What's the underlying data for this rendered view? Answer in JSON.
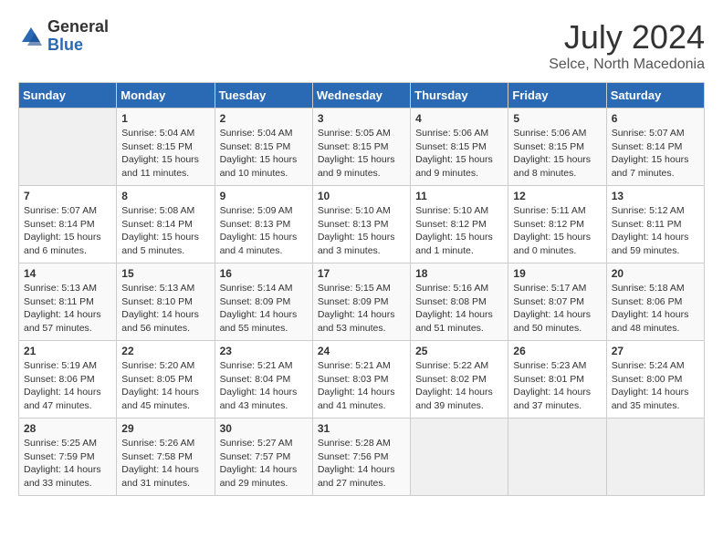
{
  "header": {
    "logo_general": "General",
    "logo_blue": "Blue",
    "month_year": "July 2024",
    "location": "Selce, North Macedonia"
  },
  "days_of_week": [
    "Sunday",
    "Monday",
    "Tuesday",
    "Wednesday",
    "Thursday",
    "Friday",
    "Saturday"
  ],
  "weeks": [
    [
      {
        "day": "",
        "sunrise": "",
        "sunset": "",
        "daylight": "",
        "empty": true
      },
      {
        "day": "1",
        "sunrise": "Sunrise: 5:04 AM",
        "sunset": "Sunset: 8:15 PM",
        "daylight": "Daylight: 15 hours and 11 minutes."
      },
      {
        "day": "2",
        "sunrise": "Sunrise: 5:04 AM",
        "sunset": "Sunset: 8:15 PM",
        "daylight": "Daylight: 15 hours and 10 minutes."
      },
      {
        "day": "3",
        "sunrise": "Sunrise: 5:05 AM",
        "sunset": "Sunset: 8:15 PM",
        "daylight": "Daylight: 15 hours and 9 minutes."
      },
      {
        "day": "4",
        "sunrise": "Sunrise: 5:06 AM",
        "sunset": "Sunset: 8:15 PM",
        "daylight": "Daylight: 15 hours and 9 minutes."
      },
      {
        "day": "5",
        "sunrise": "Sunrise: 5:06 AM",
        "sunset": "Sunset: 8:15 PM",
        "daylight": "Daylight: 15 hours and 8 minutes."
      },
      {
        "day": "6",
        "sunrise": "Sunrise: 5:07 AM",
        "sunset": "Sunset: 8:14 PM",
        "daylight": "Daylight: 15 hours and 7 minutes."
      }
    ],
    [
      {
        "day": "7",
        "sunrise": "Sunrise: 5:07 AM",
        "sunset": "Sunset: 8:14 PM",
        "daylight": "Daylight: 15 hours and 6 minutes."
      },
      {
        "day": "8",
        "sunrise": "Sunrise: 5:08 AM",
        "sunset": "Sunset: 8:14 PM",
        "daylight": "Daylight: 15 hours and 5 minutes."
      },
      {
        "day": "9",
        "sunrise": "Sunrise: 5:09 AM",
        "sunset": "Sunset: 8:13 PM",
        "daylight": "Daylight: 15 hours and 4 minutes."
      },
      {
        "day": "10",
        "sunrise": "Sunrise: 5:10 AM",
        "sunset": "Sunset: 8:13 PM",
        "daylight": "Daylight: 15 hours and 3 minutes."
      },
      {
        "day": "11",
        "sunrise": "Sunrise: 5:10 AM",
        "sunset": "Sunset: 8:12 PM",
        "daylight": "Daylight: 15 hours and 1 minute."
      },
      {
        "day": "12",
        "sunrise": "Sunrise: 5:11 AM",
        "sunset": "Sunset: 8:12 PM",
        "daylight": "Daylight: 15 hours and 0 minutes."
      },
      {
        "day": "13",
        "sunrise": "Sunrise: 5:12 AM",
        "sunset": "Sunset: 8:11 PM",
        "daylight": "Daylight: 14 hours and 59 minutes."
      }
    ],
    [
      {
        "day": "14",
        "sunrise": "Sunrise: 5:13 AM",
        "sunset": "Sunset: 8:11 PM",
        "daylight": "Daylight: 14 hours and 57 minutes."
      },
      {
        "day": "15",
        "sunrise": "Sunrise: 5:13 AM",
        "sunset": "Sunset: 8:10 PM",
        "daylight": "Daylight: 14 hours and 56 minutes."
      },
      {
        "day": "16",
        "sunrise": "Sunrise: 5:14 AM",
        "sunset": "Sunset: 8:09 PM",
        "daylight": "Daylight: 14 hours and 55 minutes."
      },
      {
        "day": "17",
        "sunrise": "Sunrise: 5:15 AM",
        "sunset": "Sunset: 8:09 PM",
        "daylight": "Daylight: 14 hours and 53 minutes."
      },
      {
        "day": "18",
        "sunrise": "Sunrise: 5:16 AM",
        "sunset": "Sunset: 8:08 PM",
        "daylight": "Daylight: 14 hours and 51 minutes."
      },
      {
        "day": "19",
        "sunrise": "Sunrise: 5:17 AM",
        "sunset": "Sunset: 8:07 PM",
        "daylight": "Daylight: 14 hours and 50 minutes."
      },
      {
        "day": "20",
        "sunrise": "Sunrise: 5:18 AM",
        "sunset": "Sunset: 8:06 PM",
        "daylight": "Daylight: 14 hours and 48 minutes."
      }
    ],
    [
      {
        "day": "21",
        "sunrise": "Sunrise: 5:19 AM",
        "sunset": "Sunset: 8:06 PM",
        "daylight": "Daylight: 14 hours and 47 minutes."
      },
      {
        "day": "22",
        "sunrise": "Sunrise: 5:20 AM",
        "sunset": "Sunset: 8:05 PM",
        "daylight": "Daylight: 14 hours and 45 minutes."
      },
      {
        "day": "23",
        "sunrise": "Sunrise: 5:21 AM",
        "sunset": "Sunset: 8:04 PM",
        "daylight": "Daylight: 14 hours and 43 minutes."
      },
      {
        "day": "24",
        "sunrise": "Sunrise: 5:21 AM",
        "sunset": "Sunset: 8:03 PM",
        "daylight": "Daylight: 14 hours and 41 minutes."
      },
      {
        "day": "25",
        "sunrise": "Sunrise: 5:22 AM",
        "sunset": "Sunset: 8:02 PM",
        "daylight": "Daylight: 14 hours and 39 minutes."
      },
      {
        "day": "26",
        "sunrise": "Sunrise: 5:23 AM",
        "sunset": "Sunset: 8:01 PM",
        "daylight": "Daylight: 14 hours and 37 minutes."
      },
      {
        "day": "27",
        "sunrise": "Sunrise: 5:24 AM",
        "sunset": "Sunset: 8:00 PM",
        "daylight": "Daylight: 14 hours and 35 minutes."
      }
    ],
    [
      {
        "day": "28",
        "sunrise": "Sunrise: 5:25 AM",
        "sunset": "Sunset: 7:59 PM",
        "daylight": "Daylight: 14 hours and 33 minutes."
      },
      {
        "day": "29",
        "sunrise": "Sunrise: 5:26 AM",
        "sunset": "Sunset: 7:58 PM",
        "daylight": "Daylight: 14 hours and 31 minutes."
      },
      {
        "day": "30",
        "sunrise": "Sunrise: 5:27 AM",
        "sunset": "Sunset: 7:57 PM",
        "daylight": "Daylight: 14 hours and 29 minutes."
      },
      {
        "day": "31",
        "sunrise": "Sunrise: 5:28 AM",
        "sunset": "Sunset: 7:56 PM",
        "daylight": "Daylight: 14 hours and 27 minutes."
      },
      {
        "day": "",
        "sunrise": "",
        "sunset": "",
        "daylight": "",
        "empty": true
      },
      {
        "day": "",
        "sunrise": "",
        "sunset": "",
        "daylight": "",
        "empty": true
      },
      {
        "day": "",
        "sunrise": "",
        "sunset": "",
        "daylight": "",
        "empty": true
      }
    ]
  ]
}
